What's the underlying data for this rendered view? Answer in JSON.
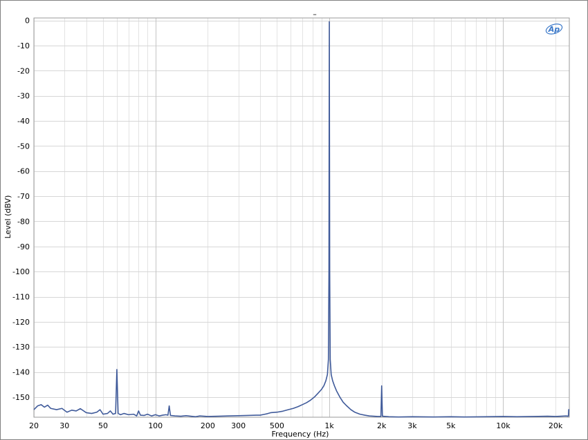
{
  "chart_data": {
    "type": "line",
    "title": "",
    "xlabel": "Frequency (Hz)",
    "ylabel": "Level (dBV)",
    "x_scale": "log",
    "xlim": [
      20,
      24000
    ],
    "ylim": [
      -158,
      1
    ],
    "grid": true,
    "x_ticks": [
      {
        "value": 20,
        "label": "20"
      },
      {
        "value": 30,
        "label": "30"
      },
      {
        "value": 50,
        "label": "50"
      },
      {
        "value": 100,
        "label": "100"
      },
      {
        "value": 200,
        "label": "200"
      },
      {
        "value": 300,
        "label": "300"
      },
      {
        "value": 500,
        "label": "500"
      },
      {
        "value": 1000,
        "label": "1k"
      },
      {
        "value": 2000,
        "label": "2k"
      },
      {
        "value": 3000,
        "label": "3k"
      },
      {
        "value": 5000,
        "label": "5k"
      },
      {
        "value": 10000,
        "label": "10k"
      },
      {
        "value": 20000,
        "label": "20k"
      }
    ],
    "y_ticks": [
      0,
      -10,
      -20,
      -30,
      -40,
      -50,
      -60,
      -70,
      -80,
      -90,
      -100,
      -110,
      -120,
      -130,
      -140,
      -150
    ],
    "series": [
      {
        "color": "#3f5a9a",
        "points": [
          [
            20,
            -155
          ],
          [
            21,
            -153.5
          ],
          [
            22,
            -153
          ],
          [
            23,
            -154
          ],
          [
            24,
            -153.2
          ],
          [
            25,
            -154.5
          ],
          [
            27,
            -155
          ],
          [
            29,
            -154.5
          ],
          [
            31,
            -156
          ],
          [
            33,
            -155.2
          ],
          [
            35,
            -155.5
          ],
          [
            37,
            -154.6
          ],
          [
            40,
            -156.2
          ],
          [
            43,
            -156.5
          ],
          [
            46,
            -156
          ],
          [
            48,
            -155
          ],
          [
            50,
            -156.8
          ],
          [
            53,
            -156.5
          ],
          [
            55,
            -155.5
          ],
          [
            57,
            -156.8
          ],
          [
            59,
            -156.5
          ],
          [
            60,
            -139
          ],
          [
            61,
            -156.5
          ],
          [
            63,
            -157
          ],
          [
            66,
            -156.5
          ],
          [
            70,
            -157
          ],
          [
            75,
            -156.8
          ],
          [
            78,
            -157.5
          ],
          [
            80,
            -155.5
          ],
          [
            82,
            -157.2
          ],
          [
            86,
            -157.3
          ],
          [
            90,
            -156.8
          ],
          [
            95,
            -157.5
          ],
          [
            100,
            -157
          ],
          [
            105,
            -157.5
          ],
          [
            110,
            -157.2
          ],
          [
            115,
            -157
          ],
          [
            118,
            -157.2
          ],
          [
            120,
            -153.5
          ],
          [
            122,
            -157.3
          ],
          [
            130,
            -157.5
          ],
          [
            140,
            -157.6
          ],
          [
            150,
            -157.4
          ],
          [
            170,
            -157.8
          ],
          [
            180,
            -157.5
          ],
          [
            200,
            -157.7
          ],
          [
            230,
            -157.6
          ],
          [
            260,
            -157.5
          ],
          [
            300,
            -157.4
          ],
          [
            340,
            -157.3
          ],
          [
            380,
            -157.2
          ],
          [
            400,
            -157.2
          ],
          [
            420,
            -156.9
          ],
          [
            440,
            -156.6
          ],
          [
            460,
            -156.2
          ],
          [
            500,
            -156
          ],
          [
            540,
            -155.6
          ],
          [
            580,
            -155
          ],
          [
            620,
            -154.5
          ],
          [
            660,
            -153.8
          ],
          [
            700,
            -153
          ],
          [
            740,
            -152.2
          ],
          [
            780,
            -151.2
          ],
          [
            820,
            -150
          ],
          [
            860,
            -148.5
          ],
          [
            900,
            -147
          ],
          [
            930,
            -145.5
          ],
          [
            955,
            -143.5
          ],
          [
            975,
            -141
          ],
          [
            988,
            -135
          ],
          [
            995,
            -100
          ],
          [
            998,
            -40
          ],
          [
            1000,
            -0.5
          ],
          [
            1002,
            -40
          ],
          [
            1005,
            -100
          ],
          [
            1012,
            -135
          ],
          [
            1025,
            -141
          ],
          [
            1045,
            -143.5
          ],
          [
            1070,
            -145.5
          ],
          [
            1100,
            -147.5
          ],
          [
            1150,
            -150
          ],
          [
            1200,
            -152
          ],
          [
            1260,
            -153.5
          ],
          [
            1330,
            -155
          ],
          [
            1400,
            -156
          ],
          [
            1500,
            -156.8
          ],
          [
            1600,
            -157.2
          ],
          [
            1700,
            -157.5
          ],
          [
            1800,
            -157.6
          ],
          [
            1900,
            -157.7
          ],
          [
            1980,
            -157.7
          ],
          [
            2000,
            -145.5
          ],
          [
            2020,
            -157.6
          ],
          [
            2200,
            -157.8
          ],
          [
            2500,
            -157.9
          ],
          [
            3000,
            -157.8
          ],
          [
            4000,
            -157.9
          ],
          [
            5000,
            -157.8
          ],
          [
            6000,
            -157.9
          ],
          [
            8000,
            -157.8
          ],
          [
            10000,
            -157.7
          ],
          [
            12000,
            -157.8
          ],
          [
            15000,
            -157.7
          ],
          [
            18000,
            -157.6
          ],
          [
            20000,
            -157.7
          ],
          [
            23000,
            -157.5
          ],
          [
            23700,
            -157.6
          ],
          [
            23800,
            -155
          ],
          [
            24000,
            -155
          ]
        ]
      }
    ]
  },
  "marker_text": "–",
  "logo_text": "Ap"
}
